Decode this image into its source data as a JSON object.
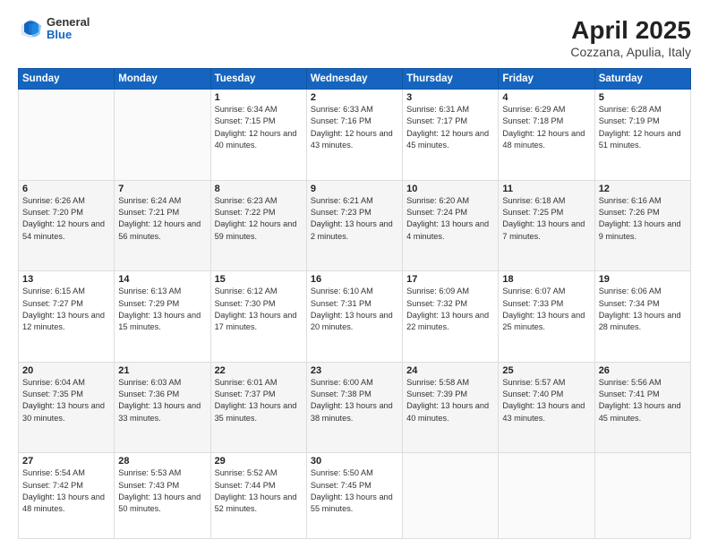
{
  "header": {
    "logo_general": "General",
    "logo_blue": "Blue",
    "title": "April 2025",
    "subtitle": "Cozzana, Apulia, Italy"
  },
  "days_of_week": [
    "Sunday",
    "Monday",
    "Tuesday",
    "Wednesday",
    "Thursday",
    "Friday",
    "Saturday"
  ],
  "weeks": [
    [
      {
        "day": "",
        "info": ""
      },
      {
        "day": "",
        "info": ""
      },
      {
        "day": "1",
        "sunrise": "Sunrise: 6:34 AM",
        "sunset": "Sunset: 7:15 PM",
        "daylight": "Daylight: 12 hours and 40 minutes."
      },
      {
        "day": "2",
        "sunrise": "Sunrise: 6:33 AM",
        "sunset": "Sunset: 7:16 PM",
        "daylight": "Daylight: 12 hours and 43 minutes."
      },
      {
        "day": "3",
        "sunrise": "Sunrise: 6:31 AM",
        "sunset": "Sunset: 7:17 PM",
        "daylight": "Daylight: 12 hours and 45 minutes."
      },
      {
        "day": "4",
        "sunrise": "Sunrise: 6:29 AM",
        "sunset": "Sunset: 7:18 PM",
        "daylight": "Daylight: 12 hours and 48 minutes."
      },
      {
        "day": "5",
        "sunrise": "Sunrise: 6:28 AM",
        "sunset": "Sunset: 7:19 PM",
        "daylight": "Daylight: 12 hours and 51 minutes."
      }
    ],
    [
      {
        "day": "6",
        "sunrise": "Sunrise: 6:26 AM",
        "sunset": "Sunset: 7:20 PM",
        "daylight": "Daylight: 12 hours and 54 minutes."
      },
      {
        "day": "7",
        "sunrise": "Sunrise: 6:24 AM",
        "sunset": "Sunset: 7:21 PM",
        "daylight": "Daylight: 12 hours and 56 minutes."
      },
      {
        "day": "8",
        "sunrise": "Sunrise: 6:23 AM",
        "sunset": "Sunset: 7:22 PM",
        "daylight": "Daylight: 12 hours and 59 minutes."
      },
      {
        "day": "9",
        "sunrise": "Sunrise: 6:21 AM",
        "sunset": "Sunset: 7:23 PM",
        "daylight": "Daylight: 13 hours and 2 minutes."
      },
      {
        "day": "10",
        "sunrise": "Sunrise: 6:20 AM",
        "sunset": "Sunset: 7:24 PM",
        "daylight": "Daylight: 13 hours and 4 minutes."
      },
      {
        "day": "11",
        "sunrise": "Sunrise: 6:18 AM",
        "sunset": "Sunset: 7:25 PM",
        "daylight": "Daylight: 13 hours and 7 minutes."
      },
      {
        "day": "12",
        "sunrise": "Sunrise: 6:16 AM",
        "sunset": "Sunset: 7:26 PM",
        "daylight": "Daylight: 13 hours and 9 minutes."
      }
    ],
    [
      {
        "day": "13",
        "sunrise": "Sunrise: 6:15 AM",
        "sunset": "Sunset: 7:27 PM",
        "daylight": "Daylight: 13 hours and 12 minutes."
      },
      {
        "day": "14",
        "sunrise": "Sunrise: 6:13 AM",
        "sunset": "Sunset: 7:29 PM",
        "daylight": "Daylight: 13 hours and 15 minutes."
      },
      {
        "day": "15",
        "sunrise": "Sunrise: 6:12 AM",
        "sunset": "Sunset: 7:30 PM",
        "daylight": "Daylight: 13 hours and 17 minutes."
      },
      {
        "day": "16",
        "sunrise": "Sunrise: 6:10 AM",
        "sunset": "Sunset: 7:31 PM",
        "daylight": "Daylight: 13 hours and 20 minutes."
      },
      {
        "day": "17",
        "sunrise": "Sunrise: 6:09 AM",
        "sunset": "Sunset: 7:32 PM",
        "daylight": "Daylight: 13 hours and 22 minutes."
      },
      {
        "day": "18",
        "sunrise": "Sunrise: 6:07 AM",
        "sunset": "Sunset: 7:33 PM",
        "daylight": "Daylight: 13 hours and 25 minutes."
      },
      {
        "day": "19",
        "sunrise": "Sunrise: 6:06 AM",
        "sunset": "Sunset: 7:34 PM",
        "daylight": "Daylight: 13 hours and 28 minutes."
      }
    ],
    [
      {
        "day": "20",
        "sunrise": "Sunrise: 6:04 AM",
        "sunset": "Sunset: 7:35 PM",
        "daylight": "Daylight: 13 hours and 30 minutes."
      },
      {
        "day": "21",
        "sunrise": "Sunrise: 6:03 AM",
        "sunset": "Sunset: 7:36 PM",
        "daylight": "Daylight: 13 hours and 33 minutes."
      },
      {
        "day": "22",
        "sunrise": "Sunrise: 6:01 AM",
        "sunset": "Sunset: 7:37 PM",
        "daylight": "Daylight: 13 hours and 35 minutes."
      },
      {
        "day": "23",
        "sunrise": "Sunrise: 6:00 AM",
        "sunset": "Sunset: 7:38 PM",
        "daylight": "Daylight: 13 hours and 38 minutes."
      },
      {
        "day": "24",
        "sunrise": "Sunrise: 5:58 AM",
        "sunset": "Sunset: 7:39 PM",
        "daylight": "Daylight: 13 hours and 40 minutes."
      },
      {
        "day": "25",
        "sunrise": "Sunrise: 5:57 AM",
        "sunset": "Sunset: 7:40 PM",
        "daylight": "Daylight: 13 hours and 43 minutes."
      },
      {
        "day": "26",
        "sunrise": "Sunrise: 5:56 AM",
        "sunset": "Sunset: 7:41 PM",
        "daylight": "Daylight: 13 hours and 45 minutes."
      }
    ],
    [
      {
        "day": "27",
        "sunrise": "Sunrise: 5:54 AM",
        "sunset": "Sunset: 7:42 PM",
        "daylight": "Daylight: 13 hours and 48 minutes."
      },
      {
        "day": "28",
        "sunrise": "Sunrise: 5:53 AM",
        "sunset": "Sunset: 7:43 PM",
        "daylight": "Daylight: 13 hours and 50 minutes."
      },
      {
        "day": "29",
        "sunrise": "Sunrise: 5:52 AM",
        "sunset": "Sunset: 7:44 PM",
        "daylight": "Daylight: 13 hours and 52 minutes."
      },
      {
        "day": "30",
        "sunrise": "Sunrise: 5:50 AM",
        "sunset": "Sunset: 7:45 PM",
        "daylight": "Daylight: 13 hours and 55 minutes."
      },
      {
        "day": "",
        "info": ""
      },
      {
        "day": "",
        "info": ""
      },
      {
        "day": "",
        "info": ""
      }
    ]
  ]
}
